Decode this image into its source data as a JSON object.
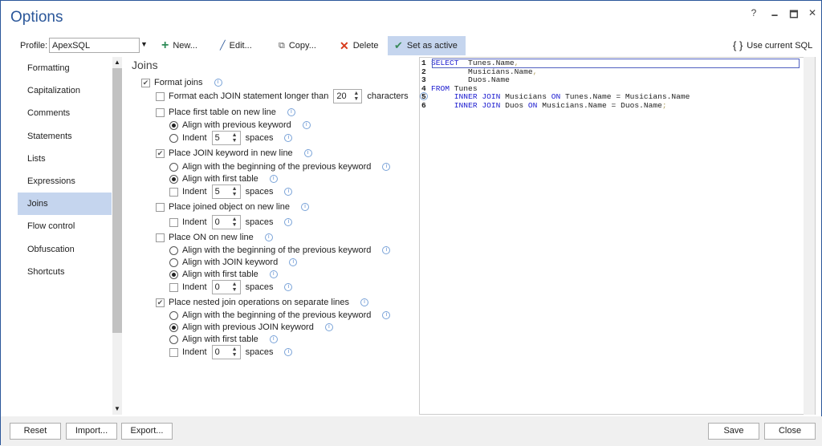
{
  "window": {
    "title": "Options",
    "help": "?",
    "minimize": "🗕",
    "maximize": "🗖",
    "close": "✕"
  },
  "toolbar": {
    "profile_label": "Profile:",
    "profile_value": "ApexSQL",
    "new": "New...",
    "edit": "Edit...",
    "copy": "Copy...",
    "delete": "Delete",
    "set_active": "Set as active",
    "use_current": "Use current SQL",
    "use_current_icon": "{ }"
  },
  "sidebar": {
    "items": [
      "Formatting",
      "Capitalization",
      "Comments",
      "Statements",
      "Lists",
      "Expressions",
      "Joins",
      "Flow control",
      "Obfuscation",
      "Shortcuts"
    ],
    "selected": "Joins"
  },
  "section_title": "Joins",
  "options": [
    {
      "type": "check",
      "checked": true,
      "label": "Format joins"
    },
    {
      "type": "check",
      "checked": false,
      "label": "Format each JOIN statement longer than",
      "spin": "20",
      "suffix": "characters"
    },
    {
      "type": "check",
      "checked": false,
      "label": "Place first table on new line"
    },
    {
      "type": "radio",
      "checked": true,
      "label": "Align with previous keyword"
    },
    {
      "type": "radio",
      "checked": false,
      "label": "Indent",
      "spin": "5",
      "suffix": "spaces"
    },
    {
      "type": "check",
      "checked": true,
      "label": "Place JOIN keyword in new line"
    },
    {
      "type": "radio",
      "checked": false,
      "label": "Align with the beginning of the previous keyword"
    },
    {
      "type": "radio",
      "checked": true,
      "label": "Align with first table"
    },
    {
      "type": "check",
      "checked": false,
      "label": "Indent",
      "spin": "5",
      "suffix": "spaces"
    },
    {
      "type": "check",
      "checked": false,
      "label": "Place joined object on new line"
    },
    {
      "type": "check",
      "checked": false,
      "label": "Indent",
      "spin": "0",
      "suffix": "spaces"
    },
    {
      "type": "check",
      "checked": false,
      "label": "Place ON on new line"
    },
    {
      "type": "radio",
      "checked": false,
      "label": "Align with the beginning of the previous keyword"
    },
    {
      "type": "radio",
      "checked": false,
      "label": "Align with JOIN keyword"
    },
    {
      "type": "radio",
      "checked": true,
      "label": "Align with first table"
    },
    {
      "type": "check",
      "checked": false,
      "label": "Indent",
      "spin": "0",
      "suffix": "spaces"
    },
    {
      "type": "check",
      "checked": true,
      "label": "Place nested join operations on separate lines"
    },
    {
      "type": "radio",
      "checked": false,
      "label": "Align with the beginning of the previous keyword"
    },
    {
      "type": "radio",
      "checked": true,
      "label": "Align with previous JOIN keyword"
    },
    {
      "type": "radio",
      "checked": false,
      "label": "Align with first table"
    },
    {
      "type": "check",
      "checked": false,
      "label": "Indent",
      "spin": "0",
      "suffix": "spaces"
    }
  ],
  "code": [
    {
      "n": "1",
      "tokens": [
        [
          "kw",
          "SELECT"
        ],
        [
          "",
          "  Tunes.Name"
        ],
        [
          "pu",
          ","
        ]
      ]
    },
    {
      "n": "2",
      "tokens": [
        [
          "",
          "        Musicians.Name"
        ],
        [
          "pu",
          ","
        ]
      ]
    },
    {
      "n": "3",
      "tokens": [
        [
          "",
          "        Duos.Name"
        ]
      ]
    },
    {
      "n": "4",
      "tokens": [
        [
          "kw",
          "FROM"
        ],
        [
          "",
          " Tunes"
        ]
      ]
    },
    {
      "n": "5",
      "tokens": [
        [
          "",
          "     "
        ],
        [
          "kw",
          "INNER JOIN"
        ],
        [
          "",
          " Musicians "
        ],
        [
          "kw",
          "ON"
        ],
        [
          "",
          " Tunes.Name = Musicians.Name"
        ]
      ]
    },
    {
      "n": "6",
      "tokens": [
        [
          "",
          "     "
        ],
        [
          "kw",
          "INNER JOIN"
        ],
        [
          "",
          " Duos "
        ],
        [
          "kw",
          "ON"
        ],
        [
          "",
          " Musicians.Name = Duos.Name"
        ],
        [
          "pu",
          ";"
        ]
      ]
    }
  ],
  "footer": {
    "reset": "Reset",
    "import": "Import...",
    "export": "Export...",
    "save": "Save",
    "close": "Close"
  }
}
